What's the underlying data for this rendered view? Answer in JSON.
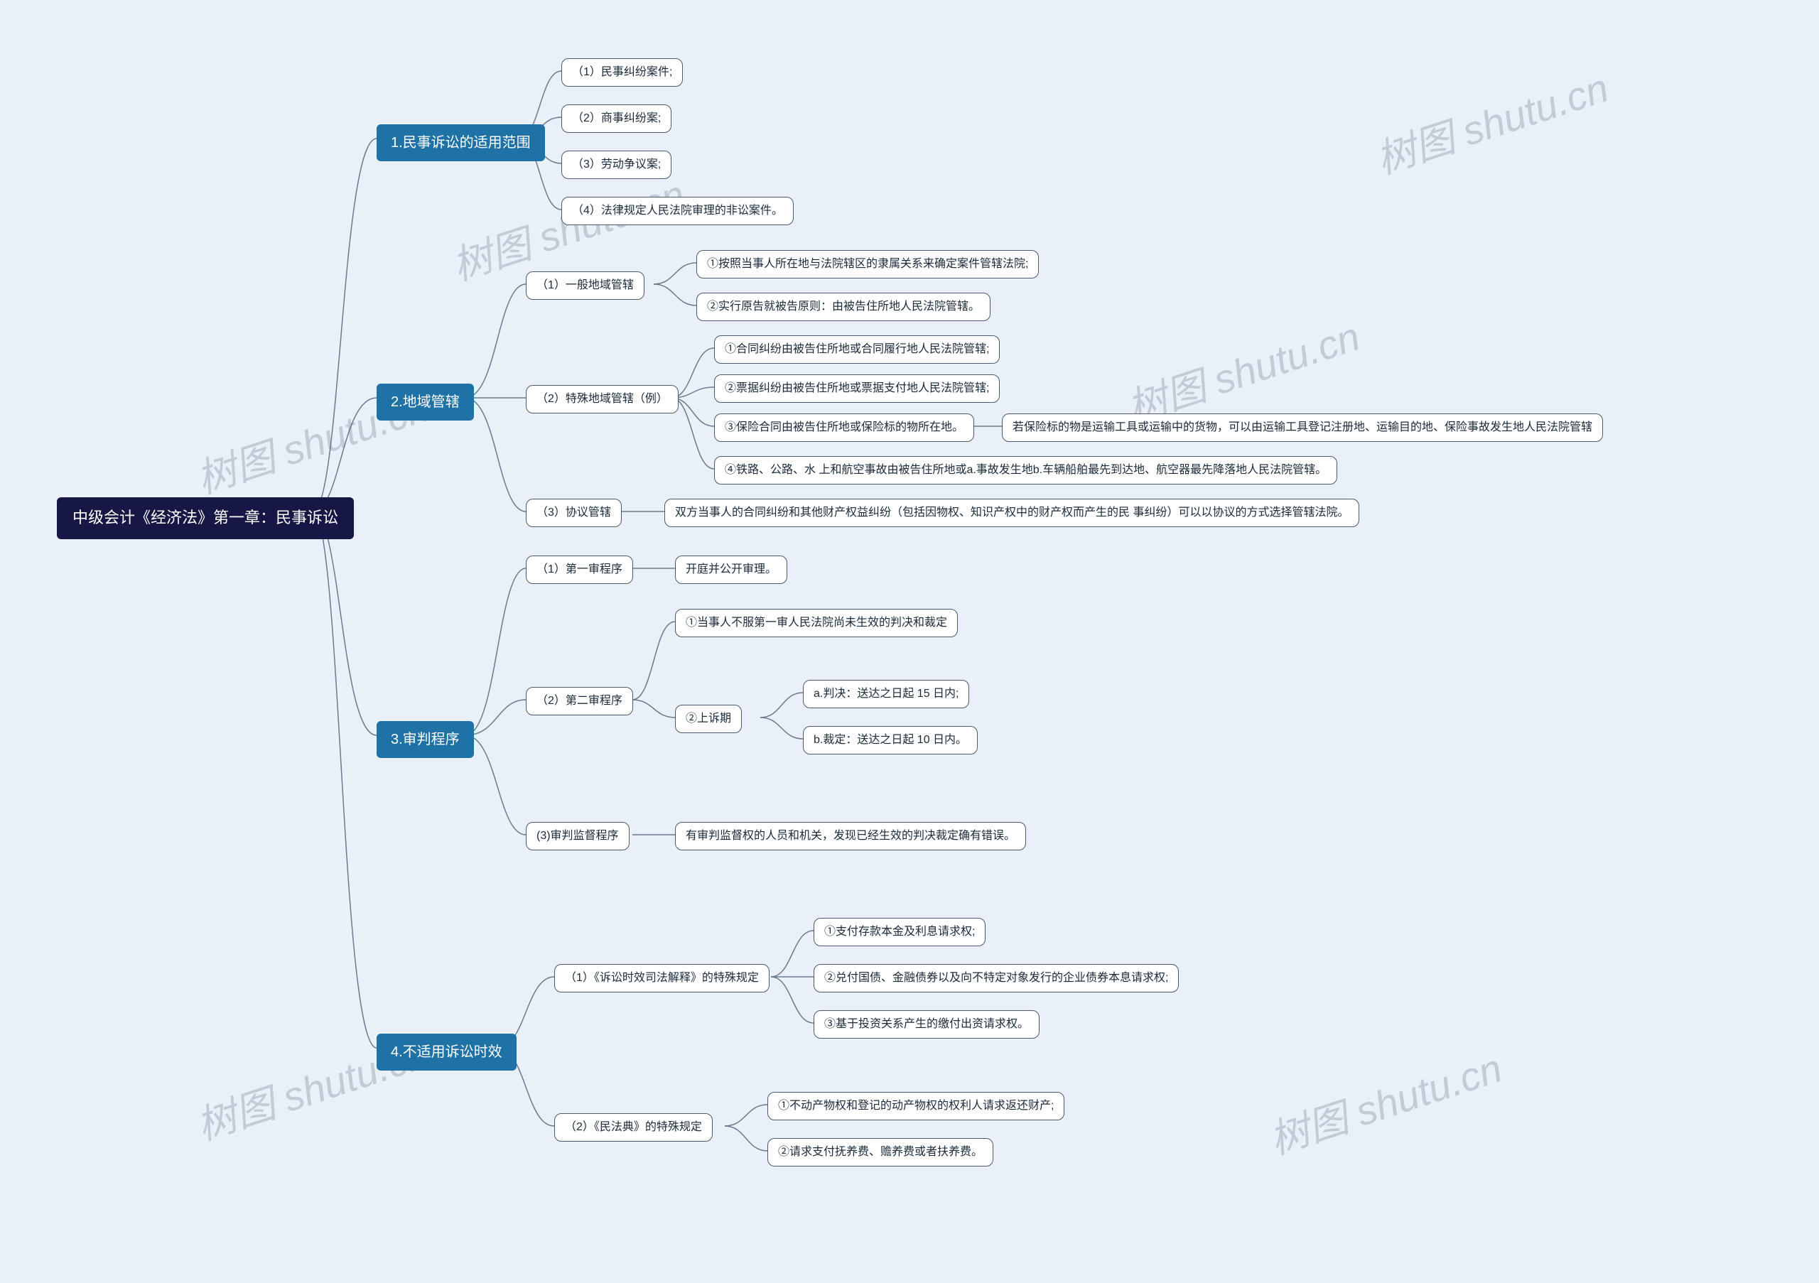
{
  "root": {
    "title": "中级会计《经济法》第一章：民事诉讼"
  },
  "branches": [
    {
      "label": "1.民事诉讼的适用范围",
      "children": [
        {
          "text": "（1）民事纠纷案件;"
        },
        {
          "text": "（2）商事纠纷案;"
        },
        {
          "text": "（3）劳动争议案;"
        },
        {
          "text": "（4）法律规定人民法院审理的非讼案件。"
        }
      ]
    },
    {
      "label": "2.地域管辖",
      "children": [
        {
          "text": "（1）一般地域管辖",
          "children": [
            {
              "text": "①按照当事人所在地与法院辖区的隶属关系来确定案件管辖法院;"
            },
            {
              "text": "②实行原告就被告原则：由被告住所地人民法院管辖。"
            }
          ]
        },
        {
          "text": "（2）特殊地域管辖（例）",
          "children": [
            {
              "text": "①合同纠纷由被告住所地或合同履行地人民法院管辖;"
            },
            {
              "text": "②票据纠纷由被告住所地或票据支付地人民法院管辖;"
            },
            {
              "text": "③保险合同由被告住所地或保险标的物所在地。",
              "children": [
                {
                  "text": "若保险标的物是运输工具或运输中的货物，可以由运输工具登记注册地、运输目的地、保险事故发生地人民法院管辖"
                }
              ]
            },
            {
              "text": "④铁路、公路、水 上和航空事故由被告住所地或a.事故发生地b.车辆船舶最先到达地、航空器最先降落地人民法院管辖。"
            }
          ]
        },
        {
          "text": "（3）协议管辖",
          "children": [
            {
              "text": "双方当事人的合同纠纷和其他财产权益纠纷（包括因物权、知识产权中的财产权而产生的民 事纠纷）可以以协议的方式选择管辖法院。"
            }
          ]
        }
      ]
    },
    {
      "label": "3.审判程序",
      "children": [
        {
          "text": "（1）第一审程序",
          "children": [
            {
              "text": "开庭并公开审理。"
            }
          ]
        },
        {
          "text": "（2）第二审程序",
          "children": [
            {
              "text": "①当事人不服第一审人民法院尚未生效的判决和裁定"
            },
            {
              "text": "②上诉期",
              "children": [
                {
                  "text": "a.判决：送达之日起 15 日内;"
                },
                {
                  "text": "b.裁定：送达之日起 10 日内。"
                }
              ]
            }
          ]
        },
        {
          "text": "(3)审判监督程序",
          "children": [
            {
              "text": "有审判监督权的人员和机关，发现已经生效的判决裁定确有错误。"
            }
          ]
        }
      ]
    },
    {
      "label": "4.不适用诉讼时效",
      "children": [
        {
          "text": "（1）《诉讼时效司法解释》的特殊规定",
          "children": [
            {
              "text": "①支付存款本金及利息请求权;"
            },
            {
              "text": "②兑付国债、金融债券以及向不特定对象发行的企业债券本息请求权;"
            },
            {
              "text": "③基于投资关系产生的缴付出资请求权。"
            }
          ]
        },
        {
          "text": "（2）《民法典》的特殊规定",
          "children": [
            {
              "text": "①不动产物权和登记的动产物权的权利人请求返还财产;"
            },
            {
              "text": "②请求支付抚养费、赡养费或者扶养费。"
            }
          ]
        }
      ]
    }
  ],
  "watermarks": [
    {
      "text": "树图 shutu.cn"
    },
    {
      "text": "树图 shutu.cn"
    },
    {
      "text": "树图 shutu.cn"
    },
    {
      "text": "树图 shutu.cn"
    },
    {
      "text": "树图 shutu.cn"
    },
    {
      "text": "树图 shutu.cn"
    }
  ]
}
